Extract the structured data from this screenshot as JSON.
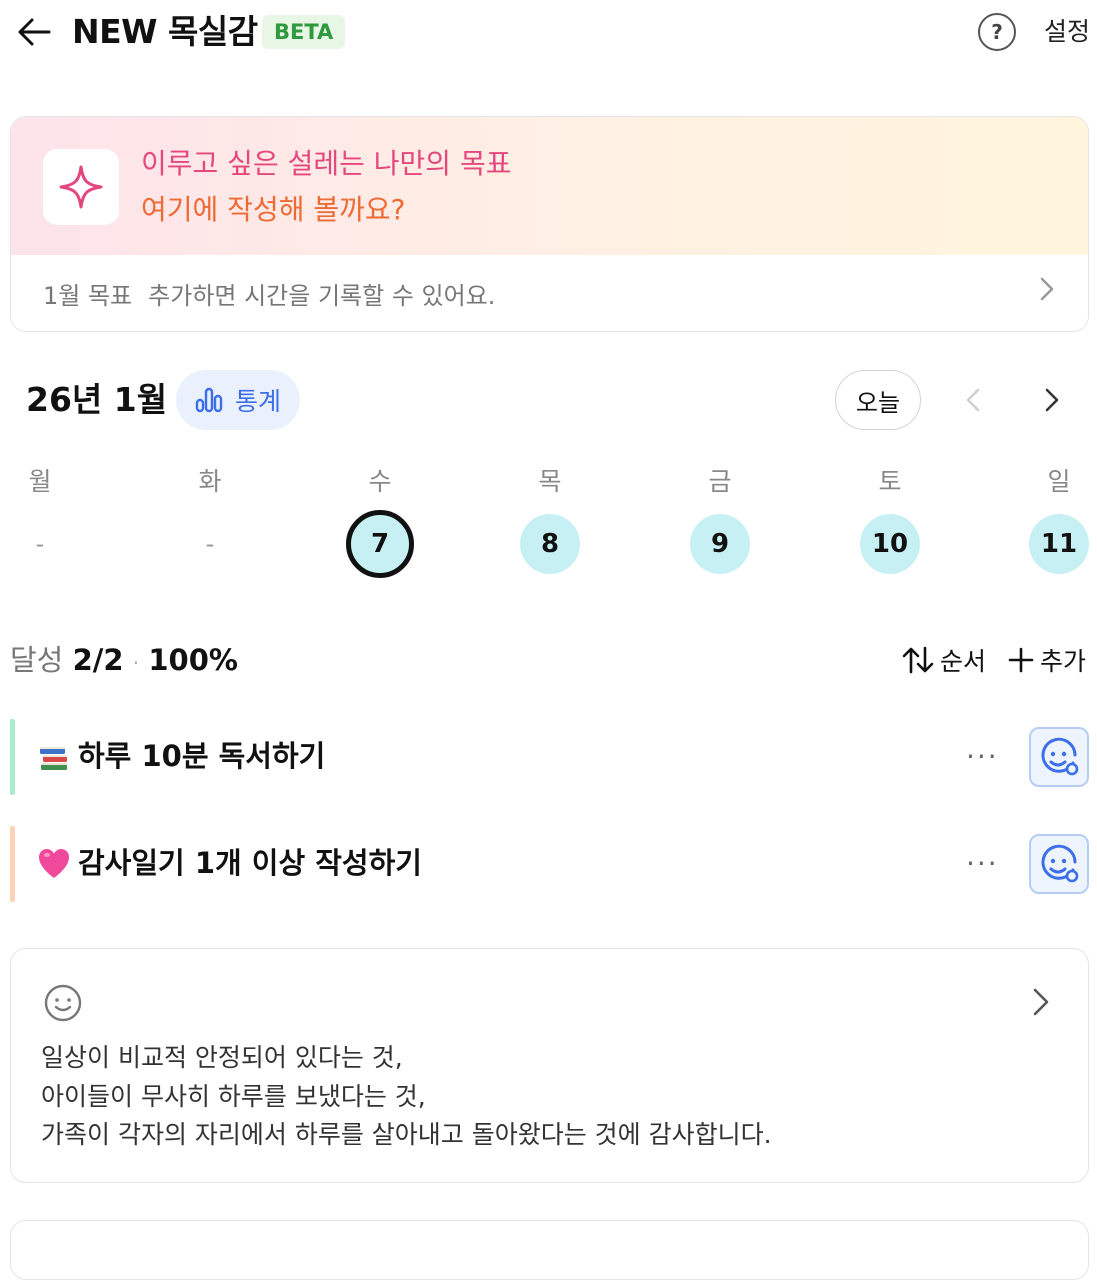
{
  "header": {
    "title": "NEW 목실감",
    "badge": "BETA",
    "help_icon_text": "?",
    "settings_label": "설정"
  },
  "goal_banner": {
    "line1": "이루고 싶은 설레는 나만의 목표",
    "line2": "여기에 작성해 볼까요?",
    "month_label": "1월 목표",
    "hint": "추가하면 시간을 기록할 수 있어요.",
    "colors": {
      "line1": "#e4477e",
      "line2": "#ee6a32"
    }
  },
  "calendar": {
    "month_label": "26년 1월",
    "stats_label": "통계",
    "today_label": "오늘",
    "weekdays": [
      "월",
      "화",
      "수",
      "목",
      "금",
      "토",
      "일"
    ],
    "days": [
      "-",
      "-",
      "7",
      "8",
      "9",
      "10",
      "11"
    ],
    "selected_day": "7"
  },
  "summary": {
    "label": "달성",
    "count": "2/2",
    "separator": "·",
    "percent": "100%",
    "sort_label": "순서",
    "add_label": "추가"
  },
  "habits": [
    {
      "emoji": "books",
      "name": "하루 10분 독서하기",
      "bar_color": "#a8ecc9",
      "more": "···"
    },
    {
      "emoji": "pink-heart",
      "name": "감사일기 1개 이상 작성하기",
      "bar_color": "#fcd3b6",
      "more": "···"
    }
  ],
  "gratitude": {
    "lines": [
      "일상이 비교적 안정되어 있다는 것,",
      "아이들이 무사히 하루를 보냈다는 것,",
      "가족이 각자의 자리에서 하루를 살아내고 돌아왔다는 것에 감사합니다."
    ]
  }
}
